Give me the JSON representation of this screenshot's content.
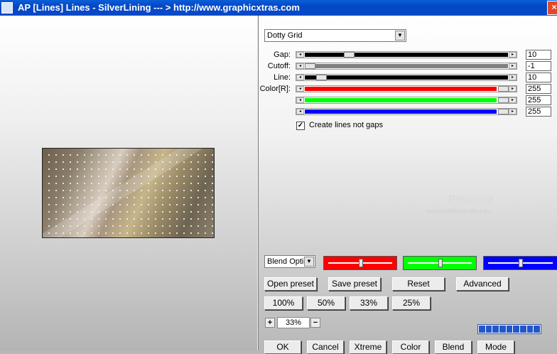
{
  "window": {
    "title": "AP [Lines]  Lines - SilverLining     --- > http://www.graphicxtras.com",
    "close_label": "×"
  },
  "effect": {
    "preset_select": "Dotty Grid"
  },
  "sliders": [
    {
      "label": "Gap:",
      "value": "10",
      "fraction": 0.2,
      "color": "#000000"
    },
    {
      "label": "Cutoff:",
      "value": "-1",
      "fraction": 0.0,
      "color": "#808080"
    },
    {
      "label": "Line:",
      "value": "10",
      "fraction": 0.05,
      "color": "#000000"
    },
    {
      "label": "Color[R]:",
      "value": "255",
      "fraction": 1.0,
      "color": "#ff0000"
    },
    {
      "label": "",
      "value": "255",
      "fraction": 1.0,
      "color": "#00ff00"
    },
    {
      "label": "",
      "value": "255",
      "fraction": 1.0,
      "color": "#0000ff"
    }
  ],
  "checkbox": {
    "label": "Create lines not gaps",
    "checked": true,
    "mark": "✓"
  },
  "watermark": {
    "name": "Pinuccia",
    "site": "www.maidiregrafica.eu"
  },
  "blend": {
    "select": "Blend Optio"
  },
  "channels": {
    "red": {
      "color": "#ff0000",
      "level": 0.5
    },
    "green": {
      "color": "#00ff00",
      "level": 0.5
    },
    "blue": {
      "color": "#0000ff",
      "level": 0.5
    }
  },
  "buttons": {
    "open_preset": "Open preset",
    "save_preset": "Save preset",
    "reset": "Reset",
    "advanced": "Advanced",
    "zoom100": "100%",
    "zoom50": "50%",
    "zoom33": "33%",
    "zoom25": "25%"
  },
  "zoom": {
    "plus": "+",
    "value": "33%",
    "minus": "−"
  },
  "bottom_buttons": {
    "ok": "OK",
    "cancel": "Cancel",
    "xtreme": "Xtreme",
    "color": "Color",
    "blend": "Blend",
    "mode": "Mode"
  },
  "colors": {
    "titlebar": "#0347c4",
    "progress": "#2456c8"
  }
}
